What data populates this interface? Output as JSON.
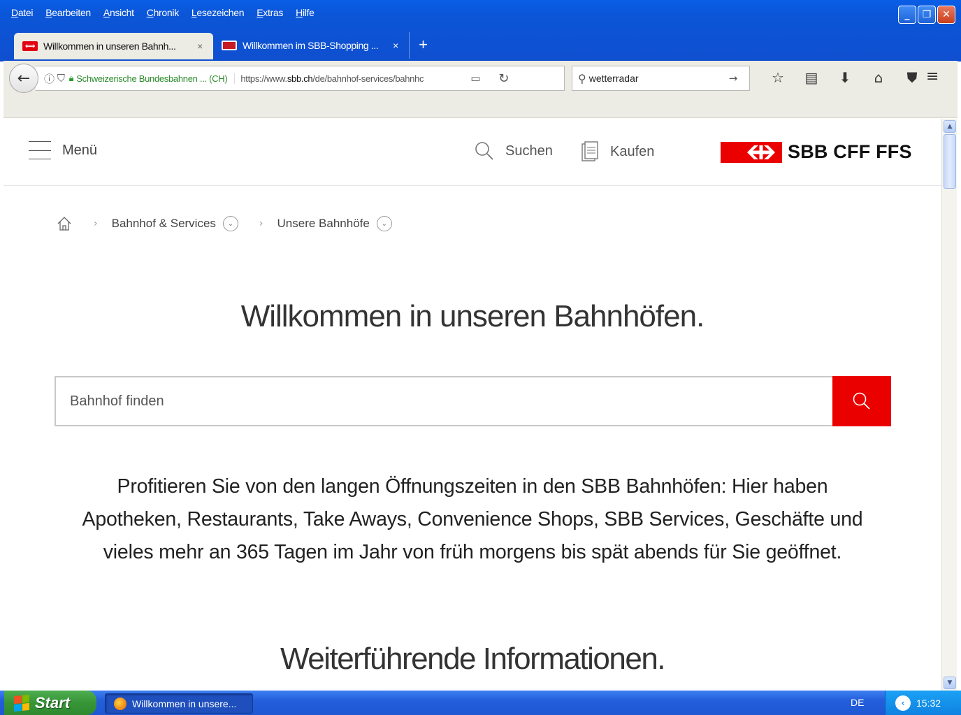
{
  "browser": {
    "menu": [
      "Datei",
      "Bearbeiten",
      "Ansicht",
      "Chronik",
      "Lesezeichen",
      "Extras",
      "Hilfe"
    ],
    "tabs": [
      {
        "label": "Willkommen in unseren Bahnh...",
        "close": "×"
      },
      {
        "label": "Willkommen im SBB-Shopping ...",
        "close": "×"
      }
    ],
    "new_tab": "+",
    "site_identity": "Schweizerische Bundesbahnen ... (CH)",
    "url_prefix": "https://www.",
    "url_domain": "sbb.ch",
    "url_path": "/de/bahnhof-services/bahnhc",
    "search_value": "wetterradar",
    "window_buttons": [
      "_",
      "❐",
      "✕"
    ]
  },
  "header": {
    "menu_label": "Menü",
    "search_label": "Suchen",
    "buy_label": "Kaufen",
    "logo_text": "SBB CFF FFS"
  },
  "breadcrumb": [
    "Bahnhof & Services",
    "Unsere Bahnhöfe"
  ],
  "main": {
    "title": "Willkommen in unseren Bahnhöfen.",
    "search_placeholder": "Bahnhof finden",
    "intro": "Profitieren Sie von den langen Öffnungszeiten in den SBB Bahnhöfen: Hier haben Apotheken, Restaurants, Take Aways, Convenience Shops, SBB Services, Geschäfte und vieles mehr an 365 Tagen im Jahr von früh morgens bis spät abends für Sie geöffnet.",
    "section_title": "Weiterführende Informationen."
  },
  "taskbar": {
    "start_label": "Start",
    "task_label": "Willkommen in unsere...",
    "language": "DE",
    "clock": "15:32"
  },
  "colors": {
    "sbb_red": "#eb0000",
    "xp_blue": "#0b56d8",
    "start_green": "#379537"
  }
}
